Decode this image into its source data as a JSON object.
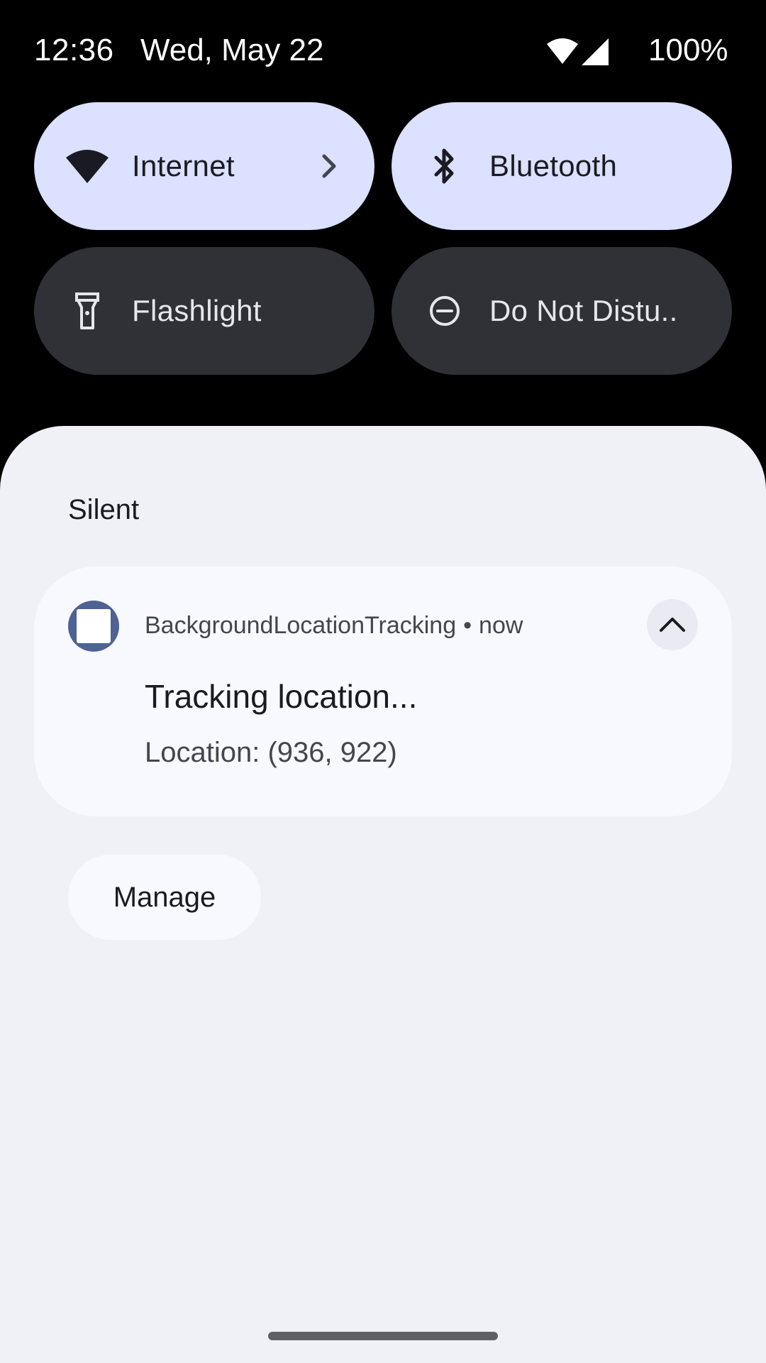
{
  "status_bar": {
    "time": "12:36",
    "date": "Wed, May 22",
    "battery": "100%",
    "wifi_icon": "wifi-icon",
    "signal_icon": "cell-signal-icon"
  },
  "quick_settings": {
    "tiles": [
      {
        "label": "Internet",
        "icon": "wifi-icon",
        "state": "on",
        "has_chevron": true
      },
      {
        "label": "Bluetooth",
        "icon": "bluetooth-icon",
        "state": "on"
      },
      {
        "label": "Flashlight",
        "icon": "flashlight-icon",
        "state": "off"
      },
      {
        "label": "Do Not Distu..",
        "icon": "do-not-disturb-icon",
        "state": "off"
      }
    ]
  },
  "notifications": {
    "section_title": "Silent",
    "card": {
      "app_name": "BackgroundLocationTracking",
      "separator": "•",
      "time": "now",
      "title": "Tracking location...",
      "text": "Location: (936, 922)",
      "app_icon": "app-square-icon",
      "expand_icon": "chevron-up-icon"
    },
    "manage_label": "Manage"
  },
  "colors": {
    "tile_active": "#dbe1fe",
    "tile_inactive": "#303136",
    "shade_background": "#f0f0f7",
    "card_background": "#f8f8ff",
    "app_icon_accent": "#4e6293"
  }
}
